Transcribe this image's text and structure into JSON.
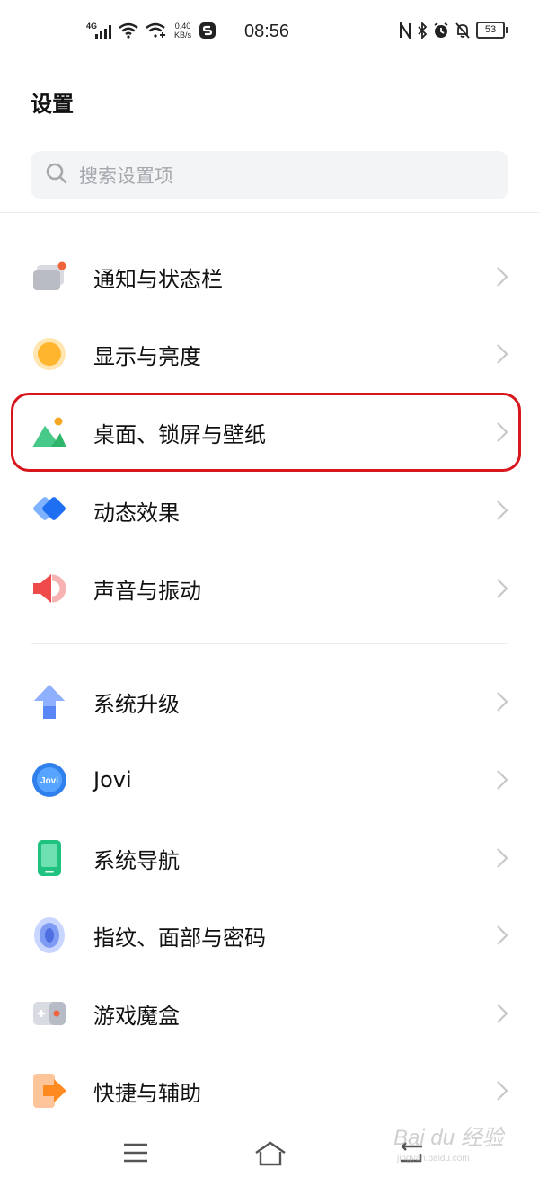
{
  "status_bar": {
    "network": "4G",
    "speed_value": "0.40",
    "speed_unit": "KB/s",
    "time": "08:56",
    "battery": "53"
  },
  "page_title": "设置",
  "search": {
    "placeholder": "搜索设置项"
  },
  "groups": [
    {
      "items": [
        {
          "label": "通知与状态栏",
          "icon": "notification-icon"
        },
        {
          "label": "显示与亮度",
          "icon": "display-icon"
        },
        {
          "label": "桌面、锁屏与壁纸",
          "icon": "wallpaper-icon",
          "highlighted": true
        },
        {
          "label": "动态效果",
          "icon": "animation-icon"
        },
        {
          "label": "声音与振动",
          "icon": "sound-icon"
        }
      ]
    },
    {
      "items": [
        {
          "label": "系统升级",
          "icon": "system-update-icon"
        },
        {
          "label": "Jovi",
          "icon": "jovi-icon"
        },
        {
          "label": "系统导航",
          "icon": "navigation-icon"
        },
        {
          "label": "指纹、面部与密码",
          "icon": "fingerprint-icon"
        },
        {
          "label": "游戏魔盒",
          "icon": "game-box-icon"
        },
        {
          "label": "快捷与辅助",
          "icon": "shortcut-icon"
        }
      ]
    }
  ],
  "jovi_badge": "Jovi",
  "highlight_color": "#d8161e",
  "watermark": {
    "brand": "Bai du 经验",
    "url": "jingyan.baidu.com"
  }
}
